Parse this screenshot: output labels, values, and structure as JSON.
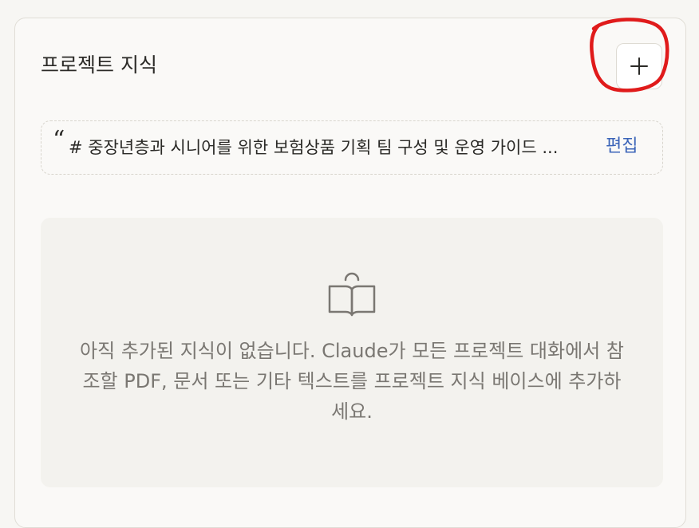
{
  "section": {
    "title": "프로젝트 지식",
    "add_button_icon": "plus-icon"
  },
  "instructions": {
    "text": "# 중장년층과 시니어를 위한 보험상품 기획 팀 구성 및 운영 가이드 ...",
    "edit_label": "편집"
  },
  "empty_state": {
    "icon": "open-book-icon",
    "message": "아직 추가된 지식이 없습니다. Claude가 모든 프로젝트 대화에서 참조할 PDF, 문서 또는 기타 텍스트를 프로젝트 지식 베이스에 추가하세요."
  },
  "colors": {
    "annotation": "#e01b1b",
    "link": "#3b64b8"
  }
}
